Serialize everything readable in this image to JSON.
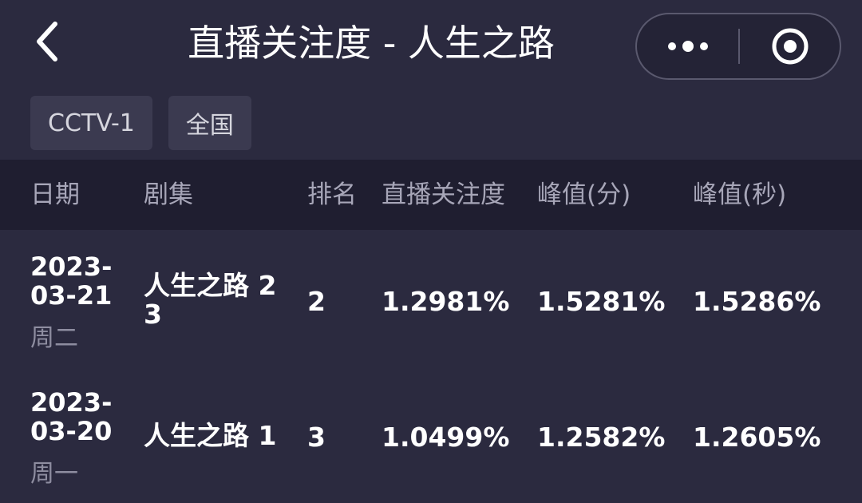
{
  "header": {
    "title": "直播关注度 - 人生之路",
    "back_icon": "chevron-left-icon",
    "more_icon": "more-dots-icon",
    "target_icon": "target-icon"
  },
  "filters": [
    "CCTV-1",
    "全国"
  ],
  "table": {
    "columns": [
      "日期",
      "剧集",
      "排名",
      "直播关注度",
      "峰值(分)",
      "峰值(秒)"
    ],
    "rows": [
      {
        "date": "2023-03-21",
        "weekday": "周二",
        "episode": "人生之路 23",
        "rank": "2",
        "attention": "1.2981%",
        "peak_min": "1.5281%",
        "peak_sec": "1.5286%"
      },
      {
        "date": "2023-03-20",
        "weekday": "周一",
        "episode": "人生之路 1",
        "rank": "3",
        "attention": "1.0499%",
        "peak_min": "1.2582%",
        "peak_sec": "1.2605%"
      }
    ]
  },
  "colors": {
    "background": "#2b2a3f",
    "header_row": "#1f1e30",
    "chip": "#3b3a50",
    "muted_text": "#8e8da0"
  }
}
